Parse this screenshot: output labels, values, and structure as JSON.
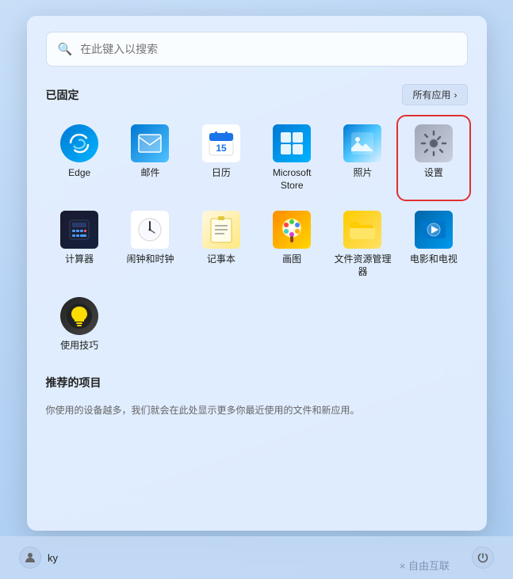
{
  "search": {
    "placeholder": "在此键入以搜索"
  },
  "pinned": {
    "title": "已固定",
    "all_apps_label": "所有应用",
    "all_apps_arrow": "›",
    "apps": [
      {
        "id": "edge",
        "label": "Edge",
        "icon_type": "edge"
      },
      {
        "id": "mail",
        "label": "邮件",
        "icon_type": "mail"
      },
      {
        "id": "calendar",
        "label": "日历",
        "icon_type": "calendar"
      },
      {
        "id": "store",
        "label": "Microsoft Store",
        "icon_type": "store"
      },
      {
        "id": "photos",
        "label": "照片",
        "icon_type": "photos"
      },
      {
        "id": "settings",
        "label": "设置",
        "icon_type": "settings",
        "highlighted": true
      },
      {
        "id": "calculator",
        "label": "计算器",
        "icon_type": "calc"
      },
      {
        "id": "clock",
        "label": "闹钟和时钟",
        "icon_type": "clock"
      },
      {
        "id": "notepad",
        "label": "记事本",
        "icon_type": "notepad"
      },
      {
        "id": "paint",
        "label": "画图",
        "icon_type": "paint"
      },
      {
        "id": "explorer",
        "label": "文件资源管理器",
        "icon_type": "explorer"
      },
      {
        "id": "movies",
        "label": "电影和电视",
        "icon_type": "movies"
      },
      {
        "id": "tips",
        "label": "使用技巧",
        "icon_type": "tips"
      }
    ]
  },
  "recommended": {
    "title": "推荐的项目",
    "desc": "你使用的设备越多，我们就会在此处显示更多你最近使用的文件和新应用。"
  },
  "taskbar": {
    "user_icon": "👤",
    "username": "ky",
    "watermark": "× 自由互联",
    "power_icon": "⏻"
  }
}
